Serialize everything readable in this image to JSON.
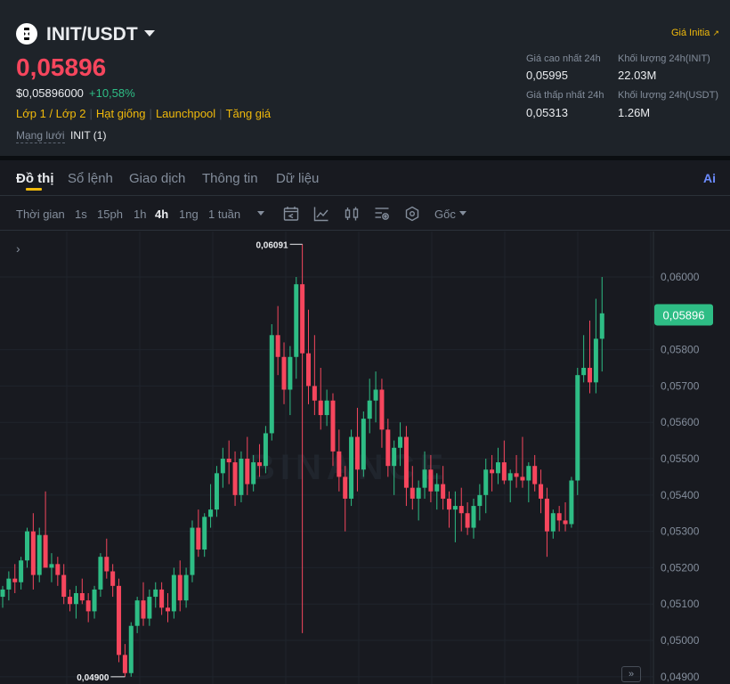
{
  "header": {
    "pair": "INIT/USDT",
    "price": "0,05896",
    "usd_price": "$0,05896000",
    "change": "+10,58%",
    "tags": [
      "Lớp 1 / Lớp 2",
      "Hạt giống",
      "Launchpool",
      "Tăng giá"
    ],
    "network_label": "Mạng lưới",
    "network_value": "INIT (1)",
    "link": "Giá Initia",
    "stats": {
      "high_label": "Giá cao nhất 24h",
      "high": "0,05995",
      "low_label": "Giá thấp nhất 24h",
      "low": "0,05313",
      "vol_base_label": "Khối lượng 24h(INIT)",
      "vol_base": "22.03M",
      "vol_quote_label": "Khối lượng 24h(USDT)",
      "vol_quote": "1.26M"
    }
  },
  "tabs": [
    "Đồ thị",
    "Sổ lệnh",
    "Giao dịch",
    "Thông tin",
    "Dữ liệu"
  ],
  "ai_label": "Ai",
  "toolbar": {
    "time_label": "Thời gian",
    "intervals": [
      "1s",
      "15ph",
      "1h",
      "4h",
      "1ng",
      "1 tuần"
    ],
    "active_interval": "4h",
    "base_label": "Gốc",
    "icons": [
      "indicator-settings-icon",
      "line-chart-icon",
      "candle-type-icon",
      "depth-settings-icon",
      "hexagon-settings-icon"
    ]
  },
  "chart_data": {
    "type": "candlestick",
    "title": "",
    "y_axis_ticks": [
      "0,06000",
      "0,05800",
      "0,05700",
      "0,05600",
      "0,05500",
      "0,05400",
      "0,05300",
      "0,05200",
      "0,05100",
      "0,05000",
      "0,04900"
    ],
    "ylim": [
      0.0488,
      0.06125
    ],
    "current_price_label": "0,05896",
    "high_marker": "0,06091",
    "low_marker": "0,04900",
    "watermark": "BINANCE",
    "colors": {
      "up": "#2ebd85",
      "down": "#f6465d",
      "price_tag": "#2ebd85"
    },
    "candles": [
      [
        0.0512,
        0.0515,
        0.0509,
        0.0514
      ],
      [
        0.0514,
        0.0519,
        0.0511,
        0.0517
      ],
      [
        0.0517,
        0.0521,
        0.0513,
        0.0516
      ],
      [
        0.0516,
        0.0523,
        0.0514,
        0.0522
      ],
      [
        0.0522,
        0.0531,
        0.052,
        0.053
      ],
      [
        0.053,
        0.0535,
        0.0514,
        0.0518
      ],
      [
        0.0518,
        0.0531,
        0.0516,
        0.0529
      ],
      [
        0.0529,
        0.0541,
        0.0521,
        0.052
      ],
      [
        0.052,
        0.0524,
        0.0516,
        0.0521
      ],
      [
        0.0521,
        0.0523,
        0.0515,
        0.0518
      ],
      [
        0.0518,
        0.0521,
        0.051,
        0.0512
      ],
      [
        0.0512,
        0.0514,
        0.0508,
        0.051
      ],
      [
        0.051,
        0.0515,
        0.0506,
        0.0513
      ],
      [
        0.0513,
        0.0517,
        0.051,
        0.0511
      ],
      [
        0.0511,
        0.0513,
        0.0505,
        0.0508
      ],
      [
        0.0508,
        0.0515,
        0.0506,
        0.0514
      ],
      [
        0.0514,
        0.0524,
        0.0512,
        0.0523
      ],
      [
        0.0523,
        0.0528,
        0.0517,
        0.0519
      ],
      [
        0.0519,
        0.0521,
        0.0512,
        0.0515
      ],
      [
        0.0515,
        0.0517,
        0.0494,
        0.0496
      ],
      [
        0.0496,
        0.0499,
        0.049,
        0.0491
      ],
      [
        0.0491,
        0.0505,
        0.049,
        0.0504
      ],
      [
        0.0504,
        0.0512,
        0.0502,
        0.0511
      ],
      [
        0.0511,
        0.0516,
        0.0504,
        0.0506
      ],
      [
        0.0506,
        0.0514,
        0.0504,
        0.0512
      ],
      [
        0.0512,
        0.0516,
        0.0509,
        0.0514
      ],
      [
        0.0514,
        0.0516,
        0.0507,
        0.0509
      ],
      [
        0.0509,
        0.0513,
        0.0505,
        0.0508
      ],
      [
        0.0508,
        0.052,
        0.0506,
        0.0518
      ],
      [
        0.0518,
        0.0522,
        0.0508,
        0.0511
      ],
      [
        0.0511,
        0.052,
        0.0509,
        0.0518
      ],
      [
        0.0518,
        0.0533,
        0.0516,
        0.0531
      ],
      [
        0.0531,
        0.0536,
        0.0523,
        0.0525
      ],
      [
        0.0525,
        0.0535,
        0.0523,
        0.0534
      ],
      [
        0.0534,
        0.0543,
        0.0531,
        0.0536
      ],
      [
        0.0536,
        0.0548,
        0.0534,
        0.0546
      ],
      [
        0.0546,
        0.0553,
        0.0542,
        0.055
      ],
      [
        0.055,
        0.0555,
        0.0543,
        0.0549
      ],
      [
        0.0549,
        0.0552,
        0.0537,
        0.054
      ],
      [
        0.054,
        0.0552,
        0.0538,
        0.055
      ],
      [
        0.055,
        0.0556,
        0.054,
        0.0543
      ],
      [
        0.0543,
        0.0551,
        0.0541,
        0.0549
      ],
      [
        0.0549,
        0.0554,
        0.0545,
        0.0548
      ],
      [
        0.0548,
        0.0559,
        0.0546,
        0.0557
      ],
      [
        0.0557,
        0.0587,
        0.0555,
        0.0584
      ],
      [
        0.0584,
        0.0592,
        0.0573,
        0.0578
      ],
      [
        0.0578,
        0.0582,
        0.0565,
        0.0569
      ],
      [
        0.0569,
        0.0581,
        0.0562,
        0.0578
      ],
      [
        0.0578,
        0.06,
        0.0572,
        0.0598
      ],
      [
        0.0598,
        0.0609,
        0.0502,
        0.0579
      ],
      [
        0.0579,
        0.0591,
        0.0565,
        0.057
      ],
      [
        0.057,
        0.0584,
        0.0562,
        0.0566
      ],
      [
        0.0566,
        0.0575,
        0.0558,
        0.0562
      ],
      [
        0.0562,
        0.0569,
        0.0559,
        0.0566
      ],
      [
        0.0566,
        0.0568,
        0.0548,
        0.0552
      ],
      [
        0.0552,
        0.0558,
        0.0541,
        0.0545
      ],
      [
        0.0545,
        0.0548,
        0.053,
        0.0539
      ],
      [
        0.0539,
        0.0558,
        0.0537,
        0.0556
      ],
      [
        0.0556,
        0.0564,
        0.0541,
        0.0547
      ],
      [
        0.0547,
        0.0563,
        0.0545,
        0.0561
      ],
      [
        0.0561,
        0.0572,
        0.0557,
        0.0566
      ],
      [
        0.0566,
        0.0574,
        0.056,
        0.0569
      ],
      [
        0.0569,
        0.0572,
        0.0553,
        0.0558
      ],
      [
        0.0558,
        0.0561,
        0.0545,
        0.0548
      ],
      [
        0.0548,
        0.0555,
        0.054,
        0.0553
      ],
      [
        0.0553,
        0.056,
        0.0548,
        0.0556
      ],
      [
        0.0556,
        0.0559,
        0.0537,
        0.0542
      ],
      [
        0.0542,
        0.0548,
        0.0536,
        0.0539
      ],
      [
        0.0539,
        0.0544,
        0.0533,
        0.0542
      ],
      [
        0.0542,
        0.0552,
        0.0539,
        0.0547
      ],
      [
        0.0547,
        0.0551,
        0.0538,
        0.0541
      ],
      [
        0.0541,
        0.0546,
        0.0536,
        0.0543
      ],
      [
        0.0543,
        0.0548,
        0.0536,
        0.0539
      ],
      [
        0.0539,
        0.0541,
        0.0531,
        0.0536
      ],
      [
        0.0536,
        0.0541,
        0.0527,
        0.0537
      ],
      [
        0.0537,
        0.0542,
        0.053,
        0.0535
      ],
      [
        0.0535,
        0.0538,
        0.0529,
        0.0531
      ],
      [
        0.0531,
        0.0539,
        0.0528,
        0.0537
      ],
      [
        0.0537,
        0.0543,
        0.0533,
        0.054
      ],
      [
        0.054,
        0.055,
        0.0535,
        0.0547
      ],
      [
        0.0547,
        0.0551,
        0.0541,
        0.0546
      ],
      [
        0.0546,
        0.0553,
        0.0543,
        0.0549
      ],
      [
        0.0549,
        0.0555,
        0.0543,
        0.0544
      ],
      [
        0.0544,
        0.0547,
        0.0538,
        0.0546
      ],
      [
        0.0546,
        0.0551,
        0.0542,
        0.0545
      ],
      [
        0.0545,
        0.0556,
        0.0542,
        0.0544
      ],
      [
        0.0544,
        0.0549,
        0.0538,
        0.0548
      ],
      [
        0.0548,
        0.0551,
        0.0541,
        0.0543
      ],
      [
        0.0543,
        0.0547,
        0.0535,
        0.0539
      ],
      [
        0.0539,
        0.0542,
        0.0523,
        0.053
      ],
      [
        0.053,
        0.0536,
        0.0528,
        0.0535
      ],
      [
        0.0535,
        0.0537,
        0.053,
        0.0533
      ],
      [
        0.0533,
        0.0538,
        0.053,
        0.0532
      ],
      [
        0.0532,
        0.0545,
        0.0531,
        0.0544
      ],
      [
        0.0544,
        0.0575,
        0.054,
        0.0573
      ],
      [
        0.0573,
        0.0584,
        0.0571,
        0.0575
      ],
      [
        0.0575,
        0.0588,
        0.0568,
        0.0571
      ],
      [
        0.0571,
        0.0594,
        0.0568,
        0.0583
      ],
      [
        0.0583,
        0.06,
        0.0574,
        0.059
      ]
    ]
  }
}
